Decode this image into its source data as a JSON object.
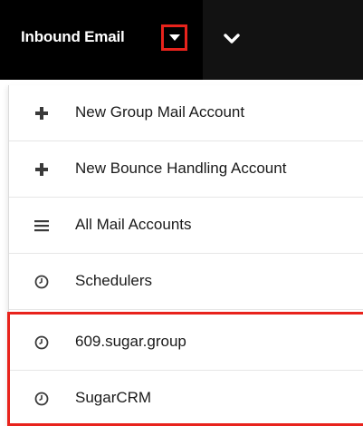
{
  "header": {
    "module_label": "Inbound Email",
    "module_menu_icon": "caret-down-icon",
    "more_icon": "chevron-down-icon"
  },
  "menu": {
    "items": [
      {
        "label": "New Group Mail Account",
        "icon": "plus-icon"
      },
      {
        "label": "New Bounce Handling Account",
        "icon": "plus-icon"
      },
      {
        "label": "All Mail Accounts",
        "icon": "list-icon"
      },
      {
        "label": "Schedulers",
        "icon": "clock-icon"
      },
      {
        "label": "609.sugar.group",
        "icon": "clock-icon"
      },
      {
        "label": "SugarCRM",
        "icon": "clock-icon"
      }
    ]
  },
  "colors": {
    "topbar": "#121212",
    "module_tab": "#000000",
    "highlight": "#e8231c",
    "menu_text": "#1a1a1a",
    "icon": "#3a3a3a"
  }
}
